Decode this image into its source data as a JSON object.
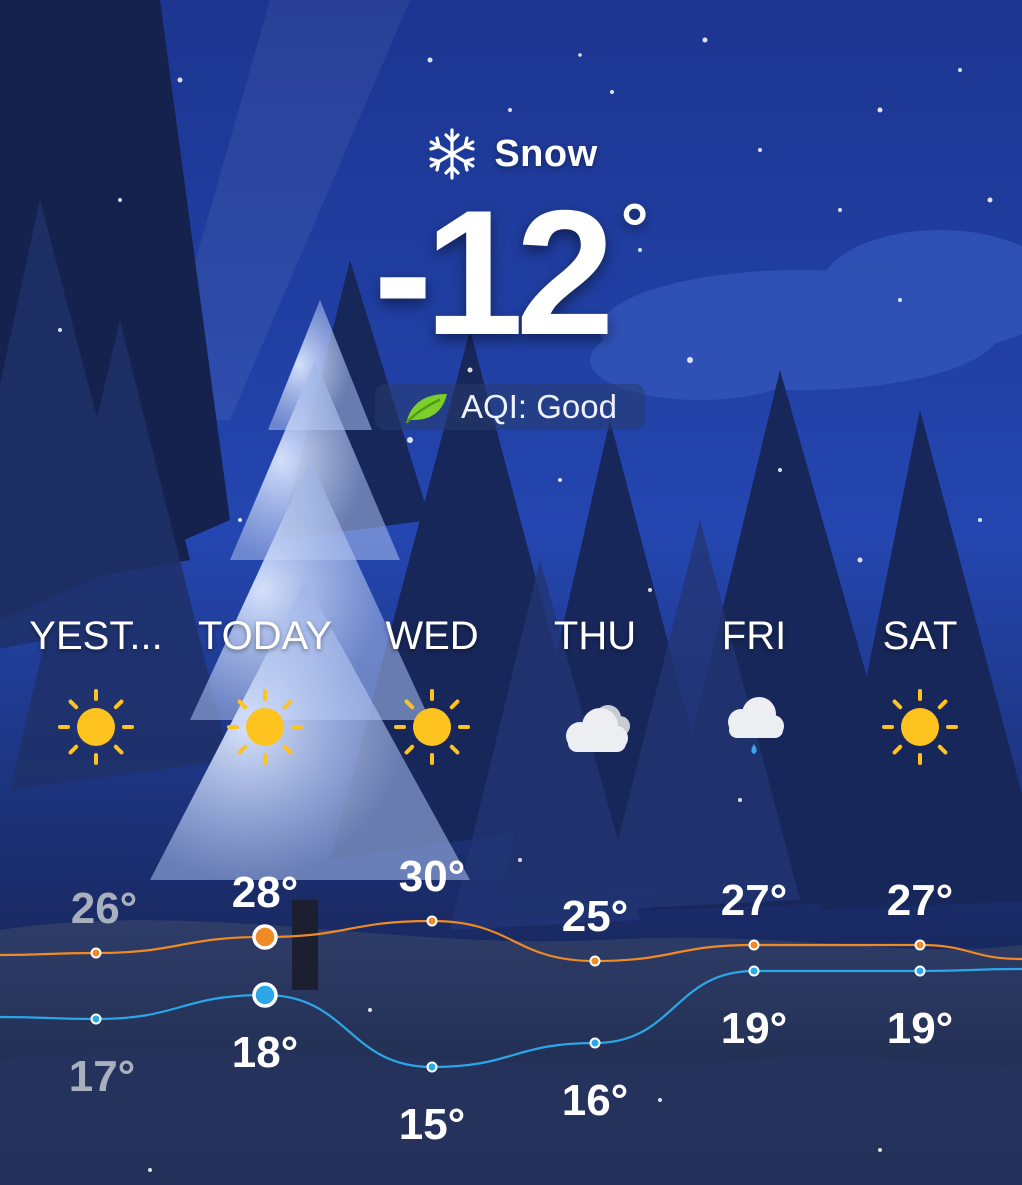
{
  "current": {
    "condition": "Snow",
    "condition_icon": "snowflake-icon",
    "temperature": "-12",
    "degree_symbol": "°",
    "aqi_icon": "leaf-icon",
    "aqi": "AQI: Good"
  },
  "forecast": {
    "days": [
      {
        "label": "YEST...",
        "icon": "sun-icon"
      },
      {
        "label": "TODAY",
        "icon": "sun-icon"
      },
      {
        "label": "WED",
        "icon": "sun-icon"
      },
      {
        "label": "THU",
        "icon": "cloudy-icon"
      },
      {
        "label": "FRI",
        "icon": "rain-cloud-icon"
      },
      {
        "label": "SAT",
        "icon": "sun-icon"
      }
    ],
    "colors": {
      "high_line": "#f08a24",
      "low_line": "#2ba7e8",
      "sun": "#ffc31f",
      "past_text": "#a9b0bd",
      "text": "#ffffff"
    }
  },
  "chart_data": {
    "type": "line",
    "categories": [
      "YEST...",
      "TODAY",
      "WED",
      "THU",
      "FRI",
      "SAT"
    ],
    "series": [
      {
        "values": [
          26,
          28,
          30,
          25,
          27,
          27
        ],
        "labels": [
          "26°",
          "28°",
          "30°",
          "25°",
          "27°",
          "27°"
        ]
      },
      {
        "values": [
          17,
          18,
          15,
          16,
          19,
          19
        ],
        "labels": [
          "17°",
          "18°",
          "15°",
          "16°",
          "19°",
          "19°"
        ]
      }
    ],
    "highlight_index": 1,
    "past_index": 0
  }
}
